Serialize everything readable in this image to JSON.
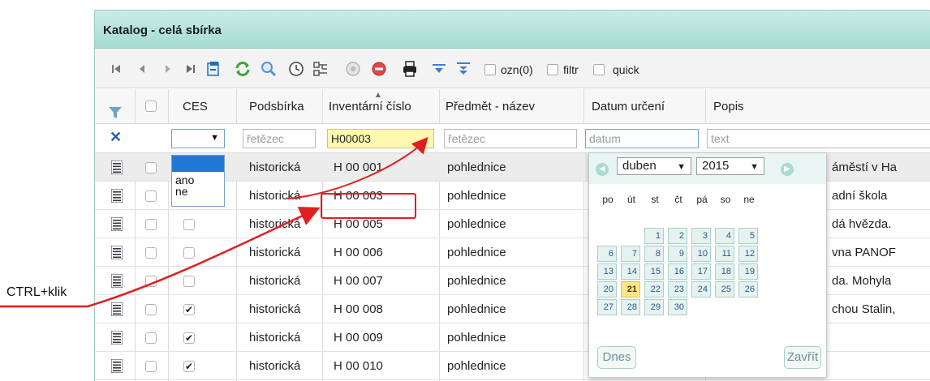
{
  "annotation": {
    "text": "CTRL+klik"
  },
  "window": {
    "title": "Katalog - celá sbírka"
  },
  "toolbar": {
    "ozn_label": "ozn(0)",
    "filtr_label": "filtr",
    "quick_label": "quick"
  },
  "columns": {
    "ces": "CES",
    "podsbirka": "Podsbírka",
    "inventarni_cislo": "Inventární číslo",
    "predmet": "Předmět - název",
    "datum": "Datum určení",
    "popis": "Popis"
  },
  "filters": {
    "clear_icon": "✕",
    "podsbirka_placeholder": "řetězec",
    "inventarni_value": "H00003",
    "predmet_placeholder": "řetězec",
    "datum_placeholder": "datum",
    "popis_placeholder": "text"
  },
  "ces_dropdown": {
    "options": [
      "ano",
      "ne"
    ]
  },
  "rows": [
    {
      "podsbirka": "historická",
      "inv": "H 00 001",
      "predmet": "pohlednice",
      "popis": "áměstí v Ha",
      "checked": false
    },
    {
      "podsbirka": "historická",
      "inv": "H 00 003",
      "predmet": "pohlednice",
      "popis": "adní škola",
      "checked": false
    },
    {
      "podsbirka": "historická",
      "inv": "H 00 005",
      "predmet": "pohlednice",
      "popis": "dá hvězda.",
      "checked": false
    },
    {
      "podsbirka": "historická",
      "inv": "H 00 006",
      "predmet": "pohlednice",
      "popis": "vna PANOF",
      "checked": false
    },
    {
      "podsbirka": "historická",
      "inv": "H 00 007",
      "predmet": "pohlednice",
      "popis": "da. Mohyla",
      "checked": false
    },
    {
      "podsbirka": "historická",
      "inv": "H 00 008",
      "predmet": "pohlednice",
      "popis": "chou Stalin,",
      "checked": true
    },
    {
      "podsbirka": "historická",
      "inv": "H 00 009",
      "predmet": "pohlednice",
      "popis": "",
      "checked": true
    },
    {
      "podsbirka": "historická",
      "inv": "H 00 010",
      "predmet": "pohlednice",
      "popis": "",
      "checked": true
    }
  ],
  "datepicker": {
    "month": "duben",
    "year": "2015",
    "weekdays": [
      "po",
      "út",
      "st",
      "čt",
      "pá",
      "so",
      "ne"
    ],
    "weeks": [
      [
        "",
        "",
        "1",
        "2",
        "3",
        "4",
        "5"
      ],
      [
        "6",
        "7",
        "8",
        "9",
        "10",
        "11",
        "12"
      ],
      [
        "13",
        "14",
        "15",
        "16",
        "17",
        "18",
        "19"
      ],
      [
        "20",
        "21",
        "22",
        "23",
        "24",
        "25",
        "26"
      ],
      [
        "27",
        "28",
        "29",
        "30",
        "",
        "",
        ""
      ]
    ],
    "today": "21",
    "today_button": "Dnes",
    "close_button": "Zavřít"
  },
  "colors": {
    "title_bar": "#a6dcd2",
    "highlight": "#e02020",
    "dropdown_selected": "#1e78d4",
    "today": "#fde589"
  }
}
